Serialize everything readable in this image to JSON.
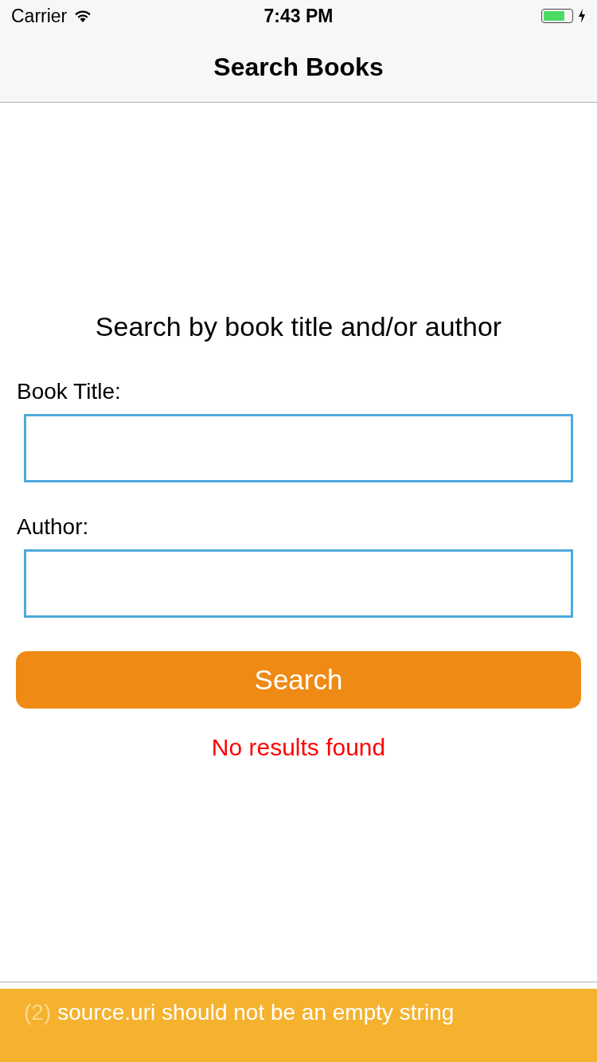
{
  "status_bar": {
    "carrier": "Carrier",
    "time": "7:43 PM"
  },
  "nav_bar": {
    "title": "Search Books"
  },
  "prompt": "Search by book title and/or author",
  "fields": [
    {
      "label": "Book Title:"
    },
    {
      "label": "Author:"
    }
  ],
  "search_button": "Search",
  "message": "No results found",
  "warning": {
    "count": "(2)",
    "text": "source.uri should not be an empty string"
  }
}
